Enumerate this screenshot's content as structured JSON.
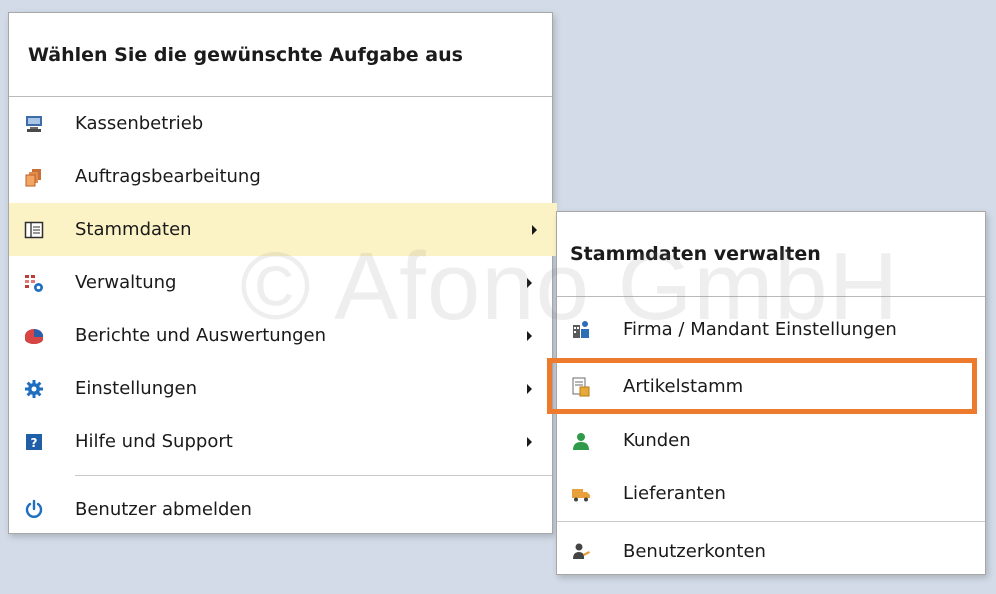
{
  "main_menu": {
    "header": "Wählen Sie die gewünschte Aufgabe aus",
    "items": [
      {
        "label": "Kassenbetrieb",
        "icon": "pos-terminal-icon",
        "submenu": false
      },
      {
        "label": "Auftragsbearbeitung",
        "icon": "orders-stack-icon",
        "submenu": false
      },
      {
        "label": "Stammdaten",
        "icon": "master-data-icon",
        "submenu": true,
        "active": true
      },
      {
        "label": "Verwaltung",
        "icon": "administration-icon",
        "submenu": true
      },
      {
        "label": "Berichte und Auswertungen",
        "icon": "pie-chart-icon",
        "submenu": true
      },
      {
        "label": "Einstellungen",
        "icon": "gear-icon",
        "submenu": true
      },
      {
        "label": "Hilfe und Support",
        "icon": "help-icon",
        "submenu": true
      }
    ],
    "logout": {
      "label": "Benutzer abmelden",
      "icon": "power-icon"
    }
  },
  "sub_menu": {
    "header": "Stammdaten verwalten",
    "items": [
      {
        "label": "Firma / Mandant Einstellungen",
        "icon": "company-icon"
      },
      {
        "label": "Artikelstamm",
        "icon": "articles-icon",
        "highlighted": true
      },
      {
        "label": "Kunden",
        "icon": "customer-icon"
      },
      {
        "label": "Lieferanten",
        "icon": "truck-icon"
      }
    ],
    "footer_item": {
      "label": "Benutzerkonten",
      "icon": "user-accounts-icon"
    }
  },
  "watermark": "© Afono GmbH",
  "colors": {
    "background": "#d2dbe7",
    "highlight": "#fbf3c6",
    "focus_border": "#ee7a2e",
    "accent_blue": "#1f6fc0"
  }
}
